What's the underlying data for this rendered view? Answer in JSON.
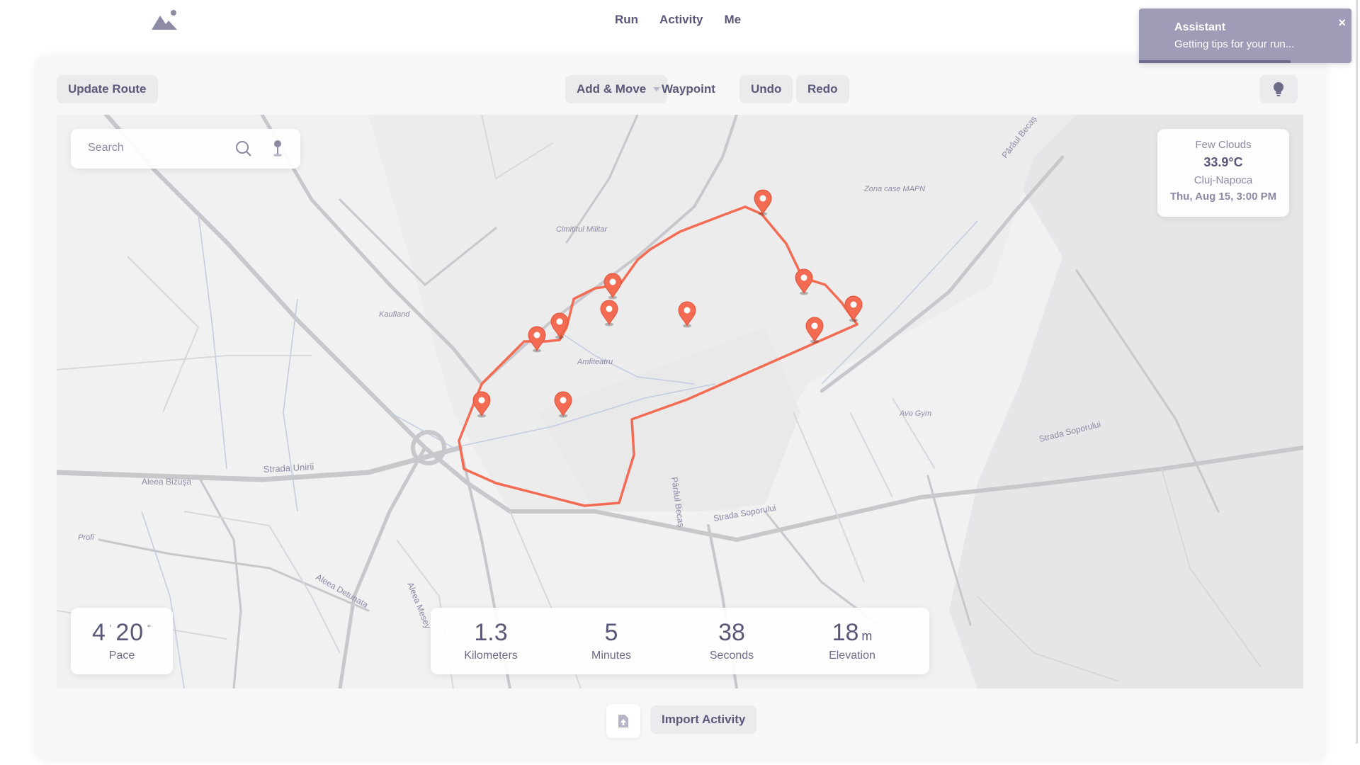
{
  "nav": {
    "items": [
      "Run",
      "Activity",
      "Me"
    ]
  },
  "toolbar": {
    "update_route": "Update Route",
    "mode": "Add & Move",
    "mode_suffix": "Waypoint",
    "undo": "Undo",
    "redo": "Redo"
  },
  "search": {
    "placeholder": "Search"
  },
  "weather": {
    "condition": "Few Clouds",
    "temperature": "33.9°C",
    "city": "Cluj-Napoca",
    "datetime": "Thu, Aug 15, 3:00 PM"
  },
  "pace": {
    "minutes": "4",
    "seconds": "20",
    "label": "Pace"
  },
  "stats": [
    {
      "value": "1.3",
      "unit": "",
      "label": "Kilometers"
    },
    {
      "value": "5",
      "unit": "",
      "label": "Minutes"
    },
    {
      "value": "38",
      "unit": "",
      "label": "Seconds"
    },
    {
      "value": "18",
      "unit": "m",
      "label": "Elevation"
    }
  ],
  "import": {
    "label": "Import Activity"
  },
  "assistant": {
    "title": "Assistant",
    "message": "Getting tips for your run...",
    "close": "×"
  },
  "map_labels": {
    "cimitirul": "Cimitirul Militar",
    "kaufland": "Kaufland",
    "amfiteatru": "Amfiteatru",
    "zona": "Zona case MAPN",
    "parau1": "Pârâul Becaș",
    "parau2": "Pârâul Becaș",
    "avo": "Avo Gym",
    "soporului1": "Strada Soporului",
    "soporului2": "Strada Soporului",
    "unirii": "Strada Unirii",
    "bizusa": "Aleea Bizușa",
    "detunata": "Aleea Detunata",
    "mesey": "Aleea Mesey",
    "profi": "Profi"
  },
  "colors": {
    "route": "#f26b52",
    "accent": "#5a5878",
    "toast": "#9e9cb6"
  },
  "icons": [
    "mountain-logo-icon",
    "search-icon",
    "pin-icon",
    "lightbulb-icon",
    "file-upload-icon",
    "waypoint-marker-icon",
    "dropdown-caret-icon"
  ]
}
